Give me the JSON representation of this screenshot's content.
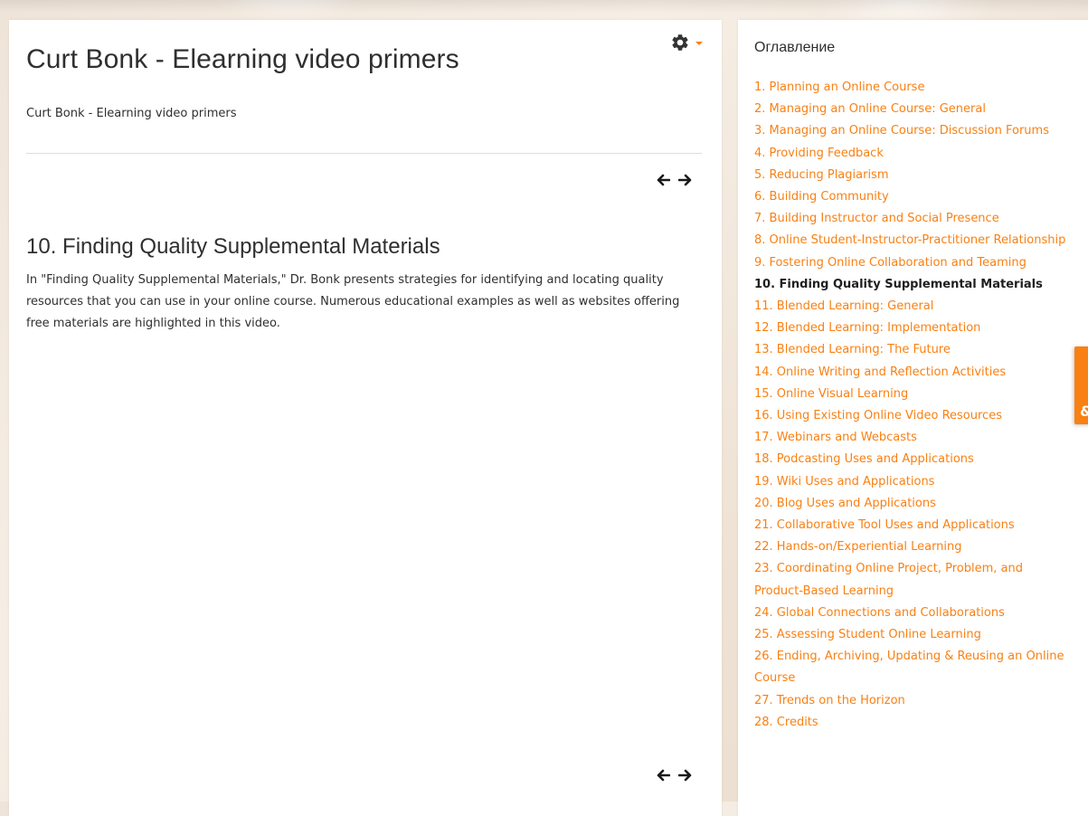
{
  "page": {
    "title": "Curt Bonk - Elearning video primers",
    "subtitle": "Curt Bonk - Elearning video primers"
  },
  "chapter": {
    "title": "10. Finding Quality Supplemental Materials",
    "body": "In \"Finding Quality Supplemental Materials,\" Dr. Bonk presents strategies for identifying and locating quality resources that you can use in your online course. Numerous educational examples as well as websites offering free materials are highlighted in this video."
  },
  "toc": {
    "heading": "Оглавление",
    "current_index": 9,
    "items": [
      "1. Planning an Online Course",
      "2. Managing an Online Course: General",
      "3. Managing an Online Course: Discussion Forums",
      "4. Providing Feedback",
      "5. Reducing Plagiarism",
      "6. Building Community",
      "7. Building Instructor and Social Presence",
      "8. Online Student-Instructor-Practitioner Relationship",
      "9. Fostering Online Collaboration and Teaming",
      "10. Finding Quality Supplemental Materials",
      "11. Blended Learning: General",
      "12. Blended Learning: Implementation",
      "13. Blended Learning: The Future",
      "14. Online Writing and Reflection Activities",
      "15. Online Visual Learning",
      "16. Using Existing Online Video Resources",
      "17. Webinars and Webcasts",
      "18. Podcasting Uses and Applications",
      "19. Wiki Uses and Applications",
      "20. Blog Uses and Applications",
      "21. Collaborative Tool Uses and Applications",
      "22. Hands-on/Experiential Learning",
      "23. Coordinating Online Project, Problem, and Product-Based Learning",
      "24. Global Connections and Collaborations",
      "25. Assessing Student Online Learning",
      "26. Ending, Archiving, Updating & Reusing an Online Course",
      "27. Trends on the Horizon",
      "28. Credits"
    ]
  },
  "side_tab": {
    "glyph": "&"
  },
  "icons": {
    "gear": "gear-icon",
    "caret": "caret-down-icon",
    "prev": "arrow-left-icon",
    "next": "arrow-right-icon"
  },
  "colors": {
    "accent": "#f98012",
    "text": "#2f2f2f",
    "current_item": "#1f1f1f"
  }
}
